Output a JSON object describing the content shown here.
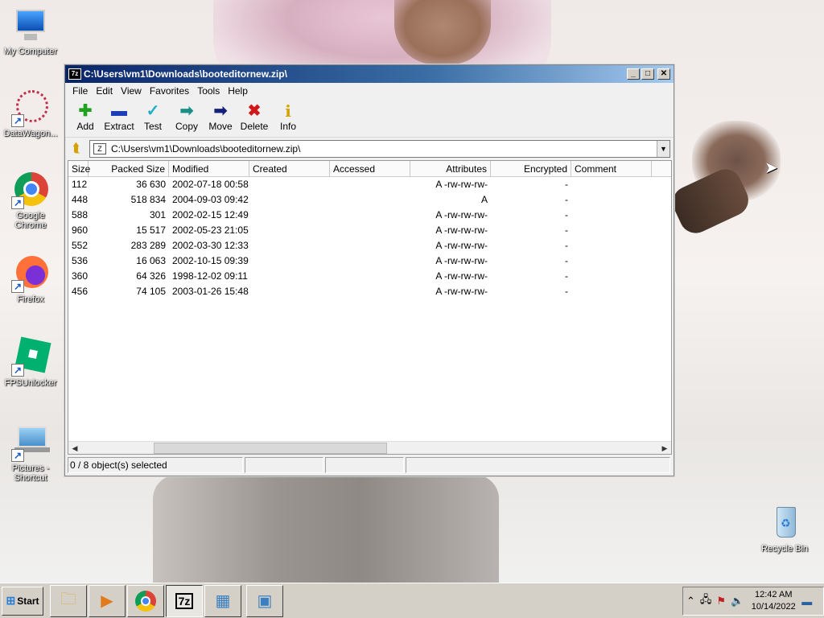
{
  "desktop": {
    "icons": [
      {
        "label": "My Computer"
      },
      {
        "label": "DataWagon..."
      },
      {
        "label": "Google Chrome"
      },
      {
        "label": "Firefox"
      },
      {
        "label": "FPSUnlocker"
      },
      {
        "label": "Pictures - Shortcut"
      },
      {
        "label": "Recycle Bin"
      }
    ]
  },
  "window": {
    "title": "C:\\Users\\vm1\\Downloads\\booteditornew.zip\\",
    "app_icon": "7z",
    "menu": [
      "File",
      "Edit",
      "View",
      "Favorites",
      "Tools",
      "Help"
    ],
    "toolbar": [
      {
        "label": "Add",
        "icon": "plus-icon",
        "glyph": "✚",
        "color": "#1fa31f"
      },
      {
        "label": "Extract",
        "icon": "minus-icon",
        "glyph": "▬",
        "color": "#1b3fb8"
      },
      {
        "label": "Test",
        "icon": "check-icon",
        "glyph": "✓",
        "color": "#1fb0c8"
      },
      {
        "label": "Copy",
        "icon": "copy-arrow-icon",
        "glyph": "➡",
        "color": "#1a8f86"
      },
      {
        "label": "Move",
        "icon": "move-arrow-icon",
        "glyph": "➡",
        "color": "#14207a"
      },
      {
        "label": "Delete",
        "icon": "delete-x-icon",
        "glyph": "✖",
        "color": "#d01818"
      },
      {
        "label": "Info",
        "icon": "info-icon",
        "glyph": "i",
        "color": "#d4a100"
      }
    ],
    "address": "C:\\Users\\vm1\\Downloads\\booteditornew.zip\\",
    "columns": [
      "Size",
      "Packed Size",
      "Modified",
      "Created",
      "Accessed",
      "Attributes",
      "Encrypted",
      "Comment"
    ],
    "rows": [
      {
        "size": "112",
        "packed": "36 630",
        "modified": "2002-07-18 00:58",
        "created": "",
        "accessed": "",
        "attributes": "A -rw-rw-rw-",
        "encrypted": "-",
        "comment": ""
      },
      {
        "size": "448",
        "packed": "518 834",
        "modified": "2004-09-03 09:42",
        "created": "",
        "accessed": "",
        "attributes": "A",
        "encrypted": "-",
        "comment": ""
      },
      {
        "size": "588",
        "packed": "301",
        "modified": "2002-02-15 12:49",
        "created": "",
        "accessed": "",
        "attributes": "A -rw-rw-rw-",
        "encrypted": "-",
        "comment": ""
      },
      {
        "size": "960",
        "packed": "15 517",
        "modified": "2002-05-23 21:05",
        "created": "",
        "accessed": "",
        "attributes": "A -rw-rw-rw-",
        "encrypted": "-",
        "comment": ""
      },
      {
        "size": "552",
        "packed": "283 289",
        "modified": "2002-03-30 12:33",
        "created": "",
        "accessed": "",
        "attributes": "A -rw-rw-rw-",
        "encrypted": "-",
        "comment": ""
      },
      {
        "size": "536",
        "packed": "16 063",
        "modified": "2002-10-15 09:39",
        "created": "",
        "accessed": "",
        "attributes": "A -rw-rw-rw-",
        "encrypted": "-",
        "comment": ""
      },
      {
        "size": "360",
        "packed": "64 326",
        "modified": "1998-12-02 09:11",
        "created": "",
        "accessed": "",
        "attributes": "A -rw-rw-rw-",
        "encrypted": "-",
        "comment": ""
      },
      {
        "size": "456",
        "packed": "74 105",
        "modified": "2003-01-26 15:48",
        "created": "",
        "accessed": "",
        "attributes": "A -rw-rw-rw-",
        "encrypted": "-",
        "comment": ""
      }
    ],
    "status": "0 / 8 object(s) selected"
  },
  "taskbar": {
    "start_label": "Start",
    "time": "12:42 AM",
    "date": "10/14/2022"
  }
}
